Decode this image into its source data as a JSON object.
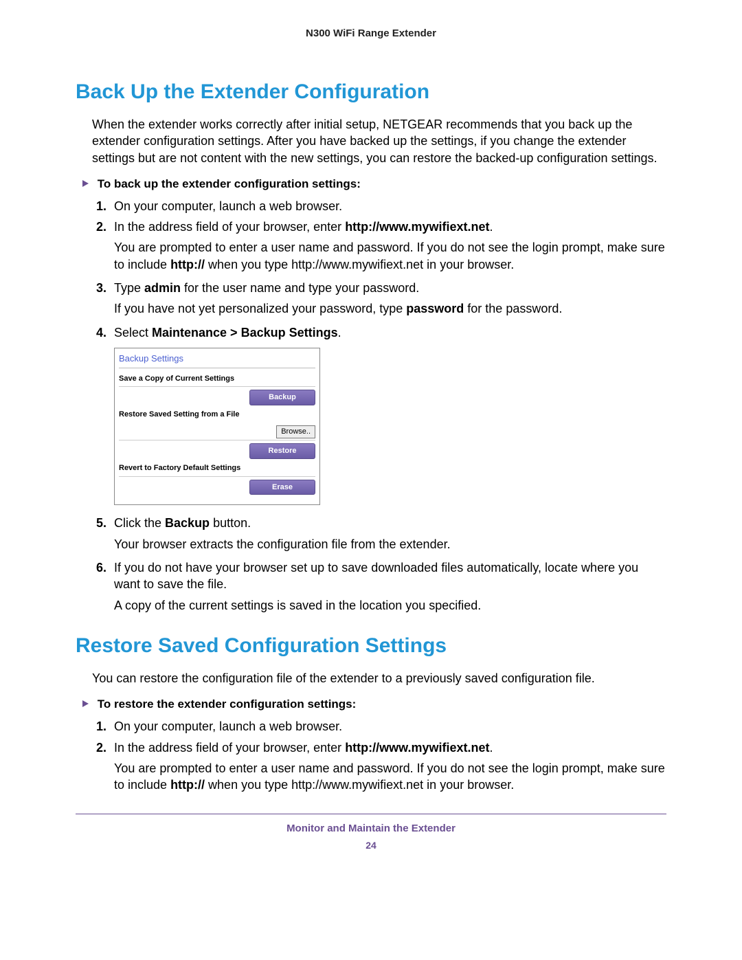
{
  "header": {
    "title": "N300 WiFi Range Extender"
  },
  "section1": {
    "title": "Back Up the Extender Configuration",
    "intro": "When the extender works correctly after initial setup, NETGEAR recommends that you back up the extender configuration settings. After you have backed up the settings, if you change the extender settings but are not content with the new settings, you can restore the backed-up configuration settings.",
    "task_heading": "To back up the extender configuration settings:",
    "steps": {
      "s1_num": "1.",
      "s1_text": "On your computer, launch a web browser.",
      "s2_num": "2.",
      "s2_pre": "In the address field of your browser, enter ",
      "s2_url": "http://www.mywifiext.net",
      "s2_post": ".",
      "s2_note_pre": "You are prompted to enter a user name and password. If you do not see the login prompt, make sure to include ",
      "s2_note_bold": "http://",
      "s2_note_post": " when you type http://www.mywifiext.net in your browser.",
      "s3_num": "3.",
      "s3_pre": "Type ",
      "s3_b1": "admin",
      "s3_post": " for the user name and type your password.",
      "s3_note_pre": "If you have not yet personalized your password, type ",
      "s3_note_bold": "password",
      "s3_note_post": " for the password.",
      "s4_num": "4.",
      "s4_pre": "Select ",
      "s4_b": "Maintenance > Backup Settings",
      "s4_post": ".",
      "s5_num": "5.",
      "s5_pre": "Click the ",
      "s5_b": "Backup",
      "s5_post": " button.",
      "s5_note": "Your browser extracts the configuration file from the extender.",
      "s6_num": "6.",
      "s6_text": "If you do not have your browser set up to save downloaded files automatically, locate where you want to save the file.",
      "s6_note": "A copy of the current settings is saved in the location you specified."
    }
  },
  "panel": {
    "title": "Backup Settings",
    "group1_label": "Save a Copy of Current Settings",
    "backup_btn": "Backup",
    "group2_label": "Restore Saved Setting from a File",
    "browse_btn": "Browse..",
    "restore_btn": "Restore",
    "group3_label": "Revert to Factory Default Settings",
    "erase_btn": "Erase"
  },
  "section2": {
    "title": "Restore Saved Configuration Settings",
    "intro": "You can restore the configuration file of the extender to a previously saved configuration file.",
    "task_heading": "To restore the extender configuration settings:",
    "steps": {
      "s1_num": "1.",
      "s1_text": "On your computer, launch a web browser.",
      "s2_num": "2.",
      "s2_pre": "In the address field of your browser, enter ",
      "s2_url": "http://www.mywifiext.net",
      "s2_post": ".",
      "s2_note_pre": "You are prompted to enter a user name and password. If you do not see the login prompt, make sure to include ",
      "s2_note_bold": "http://",
      "s2_note_post": " when you type http://www.mywifiext.net in your browser."
    }
  },
  "footer": {
    "chapter": "Monitor and Maintain the Extender",
    "page": "24"
  }
}
